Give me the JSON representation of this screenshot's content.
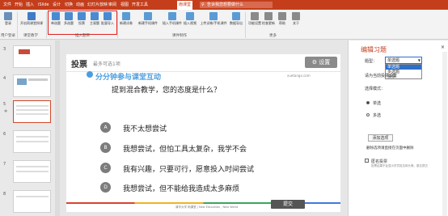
{
  "tabs": [
    "文件",
    "开始",
    "插入",
    "iSlide",
    "设计",
    "切换",
    "动画",
    "幻灯片放映",
    "审阅",
    "视图",
    "开发工具",
    "雨课堂"
  ],
  "active_tab_index": 11,
  "tell_me": "告诉我您想要做什么",
  "ribbon": {
    "buttons": [
      {
        "label": "登录",
        "icon": "login-icon"
      },
      {
        "label": "开启雨课堂授课",
        "icon": "start-class-icon"
      },
      {
        "label": "单选题",
        "icon": "single-choice-icon"
      },
      {
        "label": "多选题",
        "icon": "multi-choice-icon"
      },
      {
        "label": "投票",
        "icon": "vote-icon"
      },
      {
        "label": "主观题",
        "icon": "subjective-icon"
      },
      {
        "label": "批量导入",
        "icon": "batch-import-icon"
      },
      {
        "label": "新建试卷",
        "icon": "new-paper-icon"
      },
      {
        "label": "新建手机课件",
        "icon": "new-courseware-icon"
      },
      {
        "label": "插入手机课件",
        "icon": "insert-courseware-icon"
      },
      {
        "label": "插入视频",
        "icon": "insert-video-icon"
      },
      {
        "label": "上传试卷/手机课件",
        "icon": "upload-icon"
      },
      {
        "label": "数据导出",
        "icon": "export-icon"
      },
      {
        "label": "功能设置",
        "icon": "function-settings-icon"
      },
      {
        "label": "检查更新",
        "icon": "check-update-icon"
      },
      {
        "label": "帮助",
        "icon": "help-icon"
      },
      {
        "label": "关于",
        "icon": "about-icon"
      }
    ],
    "groups": [
      "用户登录",
      "课堂教学",
      "插入题目",
      "课件制作",
      "更多"
    ]
  },
  "slides": [
    {
      "num": "3"
    },
    {
      "num": "4"
    },
    {
      "num": "5",
      "selected": true
    },
    {
      "num": "6"
    },
    {
      "num": "7"
    },
    {
      "num": "8"
    }
  ],
  "slide": {
    "header": "投票",
    "subheader": "最多可选1项",
    "settings_label": "设置",
    "banner_title": "分分钟参与课堂互动",
    "banner_url": "xuetangx.com",
    "question": "提到混合教学，您的态度是什么？",
    "options": [
      {
        "letter": "A",
        "text": "我不太想尝试"
      },
      {
        "letter": "B",
        "text": "我想尝试，但怕工具太复杂，我学不会"
      },
      {
        "letter": "C",
        "text": "我有兴趣，只要可行，愿意投入时间尝试"
      },
      {
        "letter": "D",
        "text": "我想尝试，但不能给我造成太多麻烦"
      }
    ],
    "footer": "清华大学 雨课堂 | New Education , New World",
    "submit_label": "提交"
  },
  "right_pane": {
    "title": "编辑习题",
    "type_label": "题型：",
    "type_value": "单选题",
    "dropdown_options": [
      "单选题",
      "多选题",
      "投票"
    ],
    "dropdown_selected": 0,
    "answer_hint": "请为当前投票设置",
    "mode_label": "选择模式：",
    "mode_options": [
      "单选",
      "多选"
    ],
    "mode_selected": 0,
    "add_option_label": "添加选项",
    "delete_hint": "删除选项请直接在页面中删除",
    "anonymous_label": "匿名投票",
    "anonymous_hint": "投票结果不会显示学员姓名和头像，匿名提交"
  },
  "colors": {
    "accent": "#c43e1c",
    "banner": "#4a9de0",
    "select": "#2e6fc9"
  }
}
